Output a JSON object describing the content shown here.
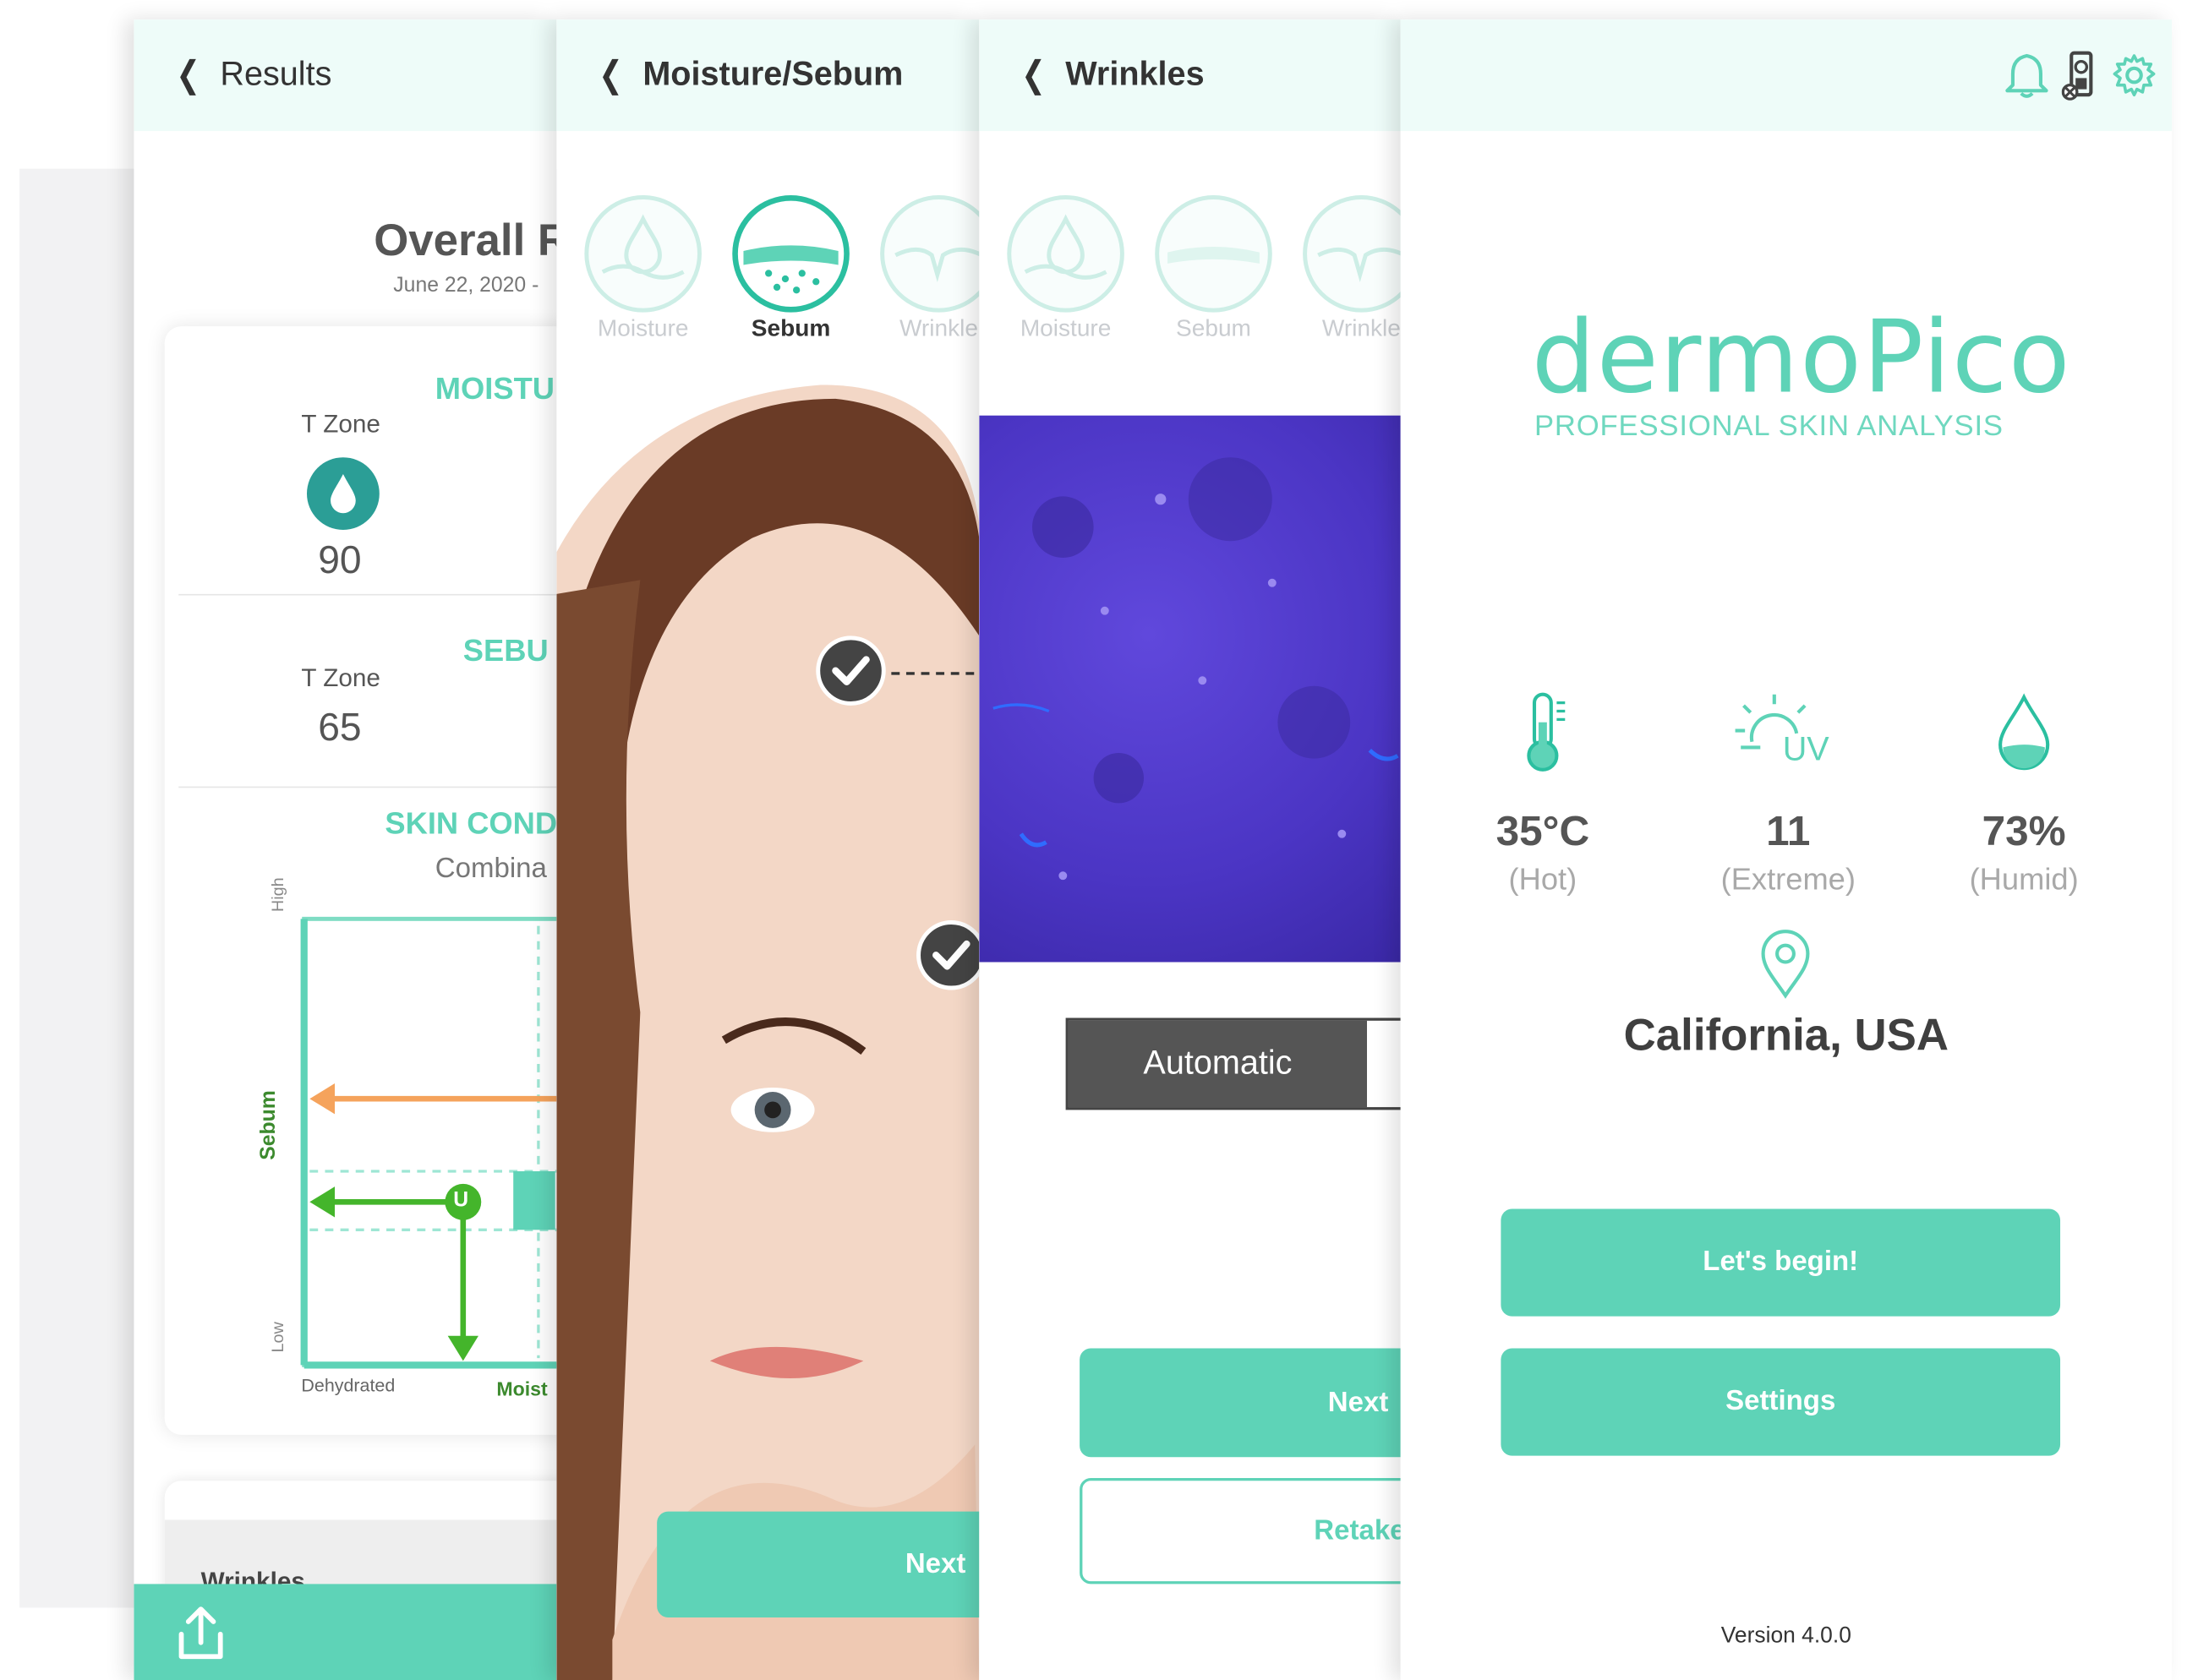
{
  "colors": {
    "teal": "#5ed3b7",
    "teal_dark": "#2bbfa0",
    "header_bg": "#eefcf9",
    "orange": "#f5a35c",
    "green": "#44b52b"
  },
  "results_screen": {
    "back_label": "Results",
    "title": "Overall R",
    "date": "June 22, 2020 -",
    "moisture_heading": "MOISTU",
    "moisture_zone": "T Zone",
    "moisture_value": "90",
    "sebum_heading": "SEBU",
    "sebum_zone": "T Zone",
    "sebum_value": "65",
    "skin_condition_heading": "SKIN COND",
    "skin_condition_value": "Combina",
    "chart_y_high": "High",
    "chart_y_low": "Low",
    "chart_y_label": "Sebum",
    "chart_x_left": "Dehydrated",
    "chart_x_right": "Moist",
    "chart_marker": "U",
    "wrinkles_label": "Wrinkles",
    "share_icon": "share-icon"
  },
  "moisture_screen": {
    "back_label": "Moisture/Sebum",
    "tabs": [
      "Moisture",
      "Sebum",
      "Wrinkle"
    ],
    "active_tab": "Sebum",
    "next_label": "Next"
  },
  "wrinkles_screen": {
    "back_label": "Wrinkles",
    "tabs": [
      "Moisture",
      "Sebum",
      "Wrinkle"
    ],
    "mode_label": "Automatic",
    "next_label": "Next",
    "retake_label": "Retake"
  },
  "home_screen": {
    "logo": "dermoPico",
    "tagline": "PROFESSIONAL SKIN ANALYSIS",
    "weather": [
      {
        "icon": "thermometer-icon",
        "value": "35°C",
        "desc": "(Hot)"
      },
      {
        "icon": "uv-sun-icon",
        "value": "11",
        "desc": "(Extreme)"
      },
      {
        "icon": "humidity-drop-icon",
        "value": "73%",
        "desc": "(Humid)"
      }
    ],
    "location": "California, USA",
    "begin_label": "Let's begin!",
    "settings_label": "Settings",
    "version": "Version 4.0.0",
    "top_icons": [
      "bell-icon",
      "device-icon",
      "gear-icon"
    ]
  }
}
